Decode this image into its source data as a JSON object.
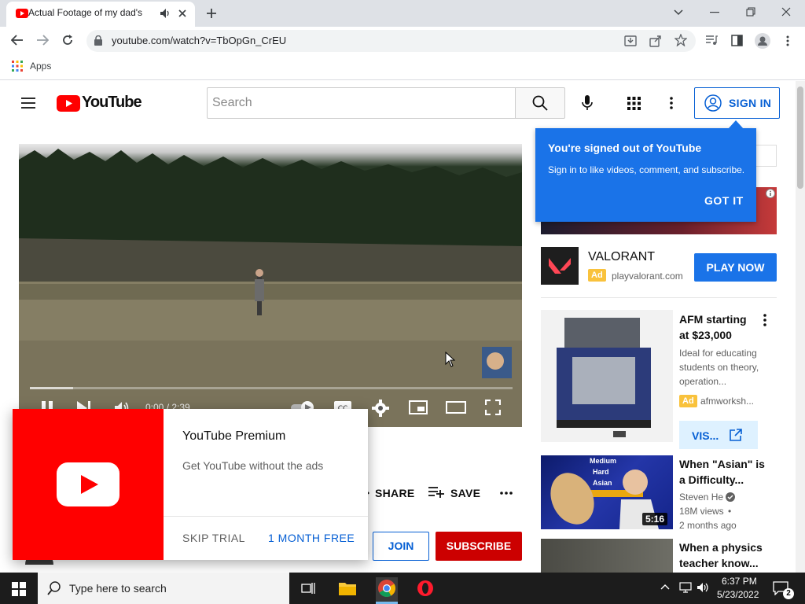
{
  "browser": {
    "tab_title": "Actual Footage of my dad's",
    "url": "youtube.com/watch?v=TbOpGn_CrEU",
    "bookmarks_apps": "Apps"
  },
  "header": {
    "logo_text": "YouTube",
    "search_placeholder": "Search",
    "sign_in": "SIGN IN"
  },
  "player": {
    "time": "0:00 / 2:39",
    "progress": 0.09
  },
  "tooltip": {
    "title": "You're signed out of YouTube",
    "body": "Sign in to like videos, comment, and subscribe.",
    "got_it": "GOT IT"
  },
  "sidebar": {
    "valorant": {
      "name": "VALORANT",
      "badge": "Ad",
      "url": "playvalorant.com",
      "cta": "PLAY NOW"
    },
    "afm": {
      "title": "AFM starting at $23,000",
      "desc": "Ideal for educating students on theory, operation...",
      "badge": "Ad",
      "advertiser": "afmworksh...",
      "cta": "VIS..."
    },
    "video1": {
      "title": "When \"Asian\" is a Difficulty...",
      "channel": "Steven He",
      "views": "18M views",
      "age": "2 months ago",
      "duration": "5:16",
      "thumb_labels": [
        "Medium",
        "Hard",
        "Asian"
      ]
    },
    "video2": {
      "title": "When a physics teacher know..."
    }
  },
  "actions": {
    "share": "SHARE",
    "save": "SAVE",
    "join": "JOIN",
    "subscribe": "SUBSCRIBE"
  },
  "premium": {
    "title": "YouTube Premium",
    "subtitle": "Get YouTube without the ads",
    "skip": "SKIP TRIAL",
    "month_free": "1 MONTH FREE"
  },
  "taskbar": {
    "search_placeholder": "Type here to search",
    "time": "6:37 PM",
    "date": "5/23/2022",
    "notifications": "2"
  },
  "colors": {
    "youtube_red": "#ff0000",
    "link_blue": "#065fd4",
    "tooltip_blue": "#1a73e8",
    "subscribe_red": "#cc0000",
    "ad_yellow": "#f9c23c"
  }
}
